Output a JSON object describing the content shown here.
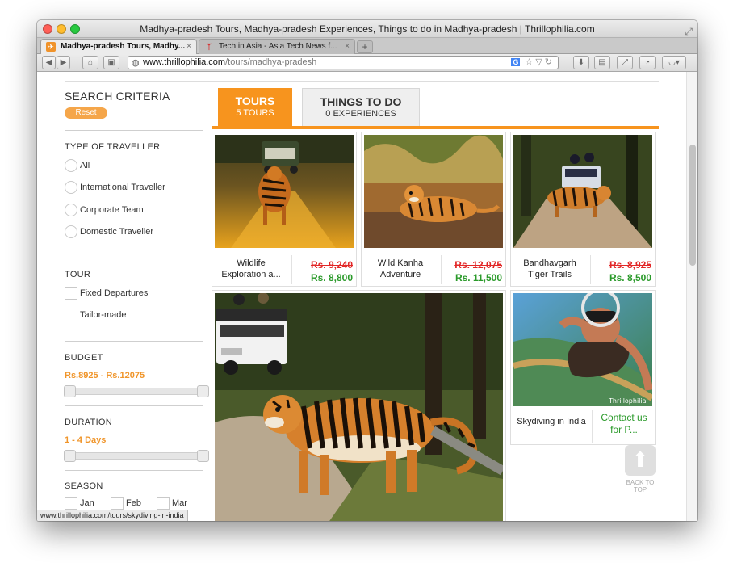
{
  "window": {
    "title": "Madhya-pradesh Tours, Madhya-pradesh Experiences, Things to do in Madhya-pradesh | Thrillophilia.com"
  },
  "browser_tabs": [
    {
      "label": "Madhya-pradesh Tours, Madhy...",
      "active": true,
      "favicon": "thrillophilia-icon"
    },
    {
      "label": "Tech in Asia - Asia Tech News f...",
      "active": false,
      "favicon": "techinasia-icon"
    }
  ],
  "address_bar": {
    "host": "www.thrillophilia.com",
    "path": "/tours/madhya-pradesh"
  },
  "sidebar": {
    "title": "SEARCH CRITERIA",
    "reset_label": "Reset",
    "traveller": {
      "title": "TYPE OF TRAVELLER",
      "options": [
        "All",
        "International Traveller",
        "Corporate Team",
        "Domestic Traveller"
      ]
    },
    "tour": {
      "title": "TOUR",
      "options": [
        "Fixed Departures",
        "Tailor-made"
      ]
    },
    "budget": {
      "title": "BUDGET",
      "range": "Rs.8925 - Rs.12075"
    },
    "duration": {
      "title": "DURATION",
      "range": "1 - 4 Days"
    },
    "season": {
      "title": "SEASON",
      "months": [
        "Jan",
        "Feb",
        "Mar"
      ]
    }
  },
  "content_tabs": {
    "tours": {
      "label": "TOURS",
      "count": "5 TOURS"
    },
    "things": {
      "label": "THINGS TO DO",
      "count": "0 EXPERIENCES"
    }
  },
  "cards": [
    {
      "name": "Wildlife Exploration a...",
      "old_price": "Rs. 9,240",
      "new_price": "Rs. 8,800"
    },
    {
      "name": "Wild Kanha Adventure",
      "old_price": "Rs. 12,075",
      "new_price": "Rs. 11,500"
    },
    {
      "name": "Bandhavgarh Tiger Trails",
      "old_price": "Rs. 8,925",
      "new_price": "Rs. 8,500"
    },
    {
      "name": "Skydiving in India",
      "contact": "Contact us for P..."
    }
  ],
  "watermark": "Thrillophilia",
  "back_to_top": "BACK TO TOP",
  "status_url": "www.thrillophilia.com/tours/skydiving-in-india",
  "colors": {
    "accent_orange": "#f7941e",
    "price_red": "#e22727",
    "price_green": "#2a9a2a"
  }
}
